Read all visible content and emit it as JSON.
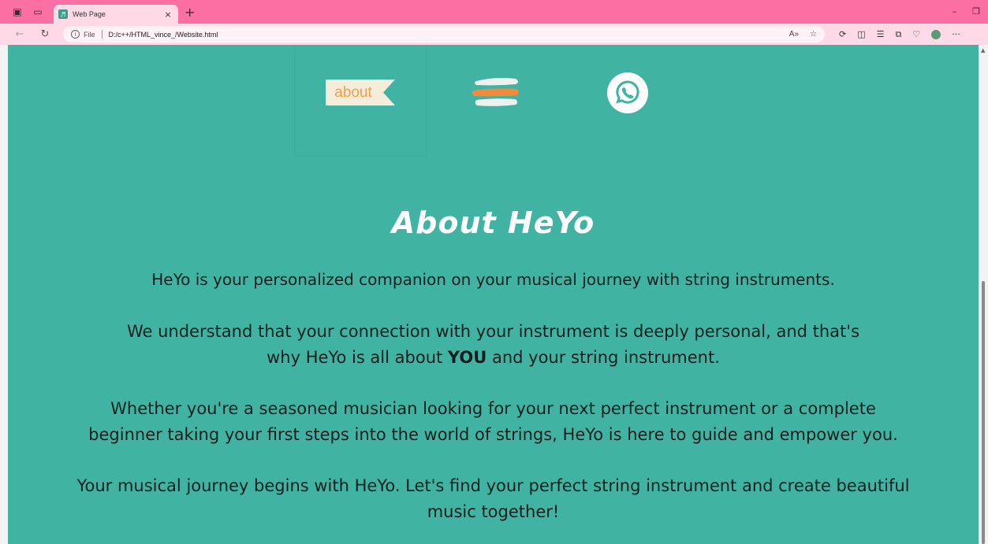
{
  "browser": {
    "tab_title": "Web Page",
    "tab_close": "×",
    "new_tab": "+",
    "address_scheme": "File",
    "address_url": "D:/c++/HTML_vince_/Website.html"
  },
  "nav": {
    "about_label": "about"
  },
  "content": {
    "title": "About HeYo",
    "p1": "HeYo is your personalized companion on your musical journey with string instruments.",
    "p2_line1": "We understand that your connection with your instrument is deeply personal, and that's",
    "p2_line2_pre": "why HeYo is all about ",
    "p2_emph": "YOU",
    "p2_line2_post": " and your string instrument.",
    "p3_line1": "Whether you're a seasoned musician looking for your next perfect instrument or a complete",
    "p3_line2": "beginner taking your first steps into the world of strings, HeYo is here to guide and empower you.",
    "p4_line1": "Your musical journey begins with HeYo. Let's find your perfect string instrument and create beautiful",
    "p4_line2": "music together!"
  },
  "colors": {
    "titlebar": "#fb6fa3",
    "toolbar": "#ffd9e6",
    "page_bg": "#41b3a2",
    "about_text": "#f0a04c",
    "menu_orange": "#f08a3c"
  },
  "icons": {
    "whatsapp": "whatsapp-icon",
    "menu": "hamburger-menu-icon"
  }
}
